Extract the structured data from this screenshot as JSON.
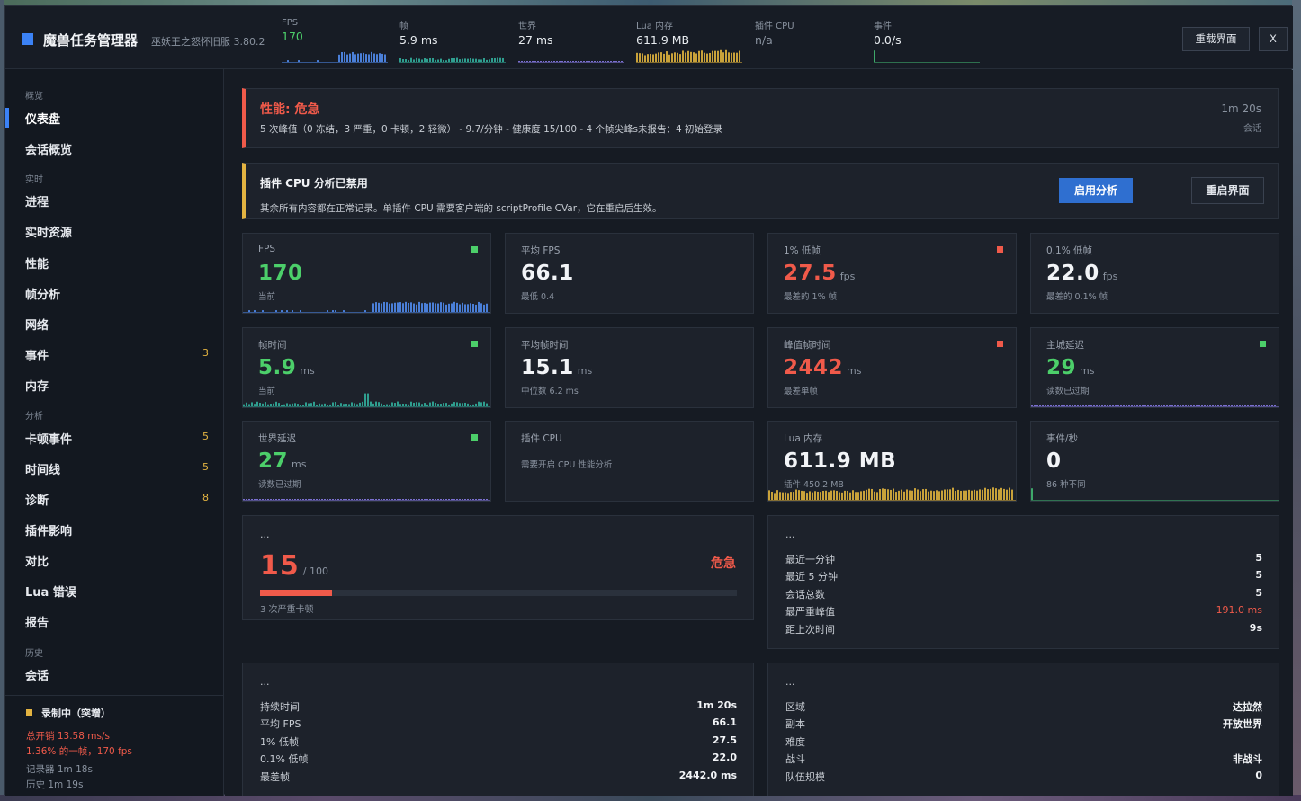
{
  "app": {
    "title": "魔兽任务管理器",
    "subtitle": "巫妖王之怒怀旧服 3.80.2",
    "reload_label": "重载界面",
    "close_label": "X"
  },
  "header_metrics": [
    {
      "label": "FPS",
      "value": "170",
      "tone": "green"
    },
    {
      "label": "帧",
      "value": "5.9 ms",
      "tone": "normal"
    },
    {
      "label": "世界",
      "value": "27 ms",
      "tone": "normal"
    },
    {
      "label": "Lua 内存",
      "value": "611.9 MB",
      "tone": "normal"
    },
    {
      "label": "插件 CPU",
      "value": "n/a",
      "tone": "dim"
    },
    {
      "label": "事件",
      "value": "0.0/s",
      "tone": "normal"
    }
  ],
  "sidebar": {
    "sections": [
      {
        "label": "概览",
        "items": [
          {
            "label": "仪表盘",
            "active": true
          },
          {
            "label": "会话概览"
          }
        ]
      },
      {
        "label": "实时",
        "items": [
          {
            "label": "进程"
          },
          {
            "label": "实时资源"
          },
          {
            "label": "性能"
          },
          {
            "label": "帧分析"
          },
          {
            "label": "网络"
          },
          {
            "label": "事件",
            "count": "3"
          },
          {
            "label": "内存"
          }
        ]
      },
      {
        "label": "分析",
        "items": [
          {
            "label": "卡顿事件",
            "count": "5"
          },
          {
            "label": "时间线",
            "count": "5"
          },
          {
            "label": "诊断",
            "count": "8"
          },
          {
            "label": "插件影响"
          },
          {
            "label": "对比"
          },
          {
            "label": "Lua 错误"
          },
          {
            "label": "报告"
          }
        ]
      },
      {
        "label": "历史",
        "items": [
          {
            "label": "会话"
          }
        ]
      }
    ],
    "footer": {
      "recording": "录制中（突增）",
      "overhead": "总开销 13.58 ms/s",
      "frame_pct": "1.36% 的一帧，170 fps",
      "recorder": "记录器 1m 18s",
      "history": "历史 1m 19s"
    }
  },
  "alert": {
    "title": "性能: 危急",
    "detail": "5 次峰值（0 冻结，3 严重，0 卡顿，2 轻微）  -  9.7/分钟  -  健康度 15/100  -  4 个帧尖峰s未报告：4 初始登录",
    "time": "1m 20s",
    "time_label": "会话"
  },
  "warning": {
    "title": "插件 CPU 分析已禁用",
    "detail": "其余所有内容都在正常记录。单插件 CPU 需要客户端的 scriptProfile CVar，它在重启后生效。",
    "enable_label": "启用分析",
    "restart_label": "重启界面"
  },
  "cards": [
    {
      "label": "FPS",
      "value": "170",
      "unit": "",
      "sub": "当前",
      "tone": "green",
      "dot": "g",
      "spark": "blue"
    },
    {
      "label": "平均 FPS",
      "value": "66.1",
      "unit": "",
      "sub": "最低 0.4",
      "tone": "normal",
      "dot": "",
      "spark": ""
    },
    {
      "label": "1% 低帧",
      "value": "27.5",
      "unit": "fps",
      "sub": "最差的 1% 帧",
      "tone": "red",
      "dot": "r",
      "spark": ""
    },
    {
      "label": "0.1% 低帧",
      "value": "22.0",
      "unit": "fps",
      "sub": "最差的 0.1% 帧",
      "tone": "normal",
      "dot": "",
      "spark": ""
    },
    {
      "label": "帧时间",
      "value": "5.9",
      "unit": "ms",
      "sub": "当前",
      "tone": "green",
      "dot": "g",
      "spark": "teal"
    },
    {
      "label": "平均帧时间",
      "value": "15.1",
      "unit": "ms",
      "sub": "中位数 6.2 ms",
      "tone": "normal",
      "dot": "",
      "spark": ""
    },
    {
      "label": "峰值帧时间",
      "value": "2442",
      "unit": "ms",
      "sub": "最差单帧",
      "tone": "red",
      "dot": "r",
      "spark": ""
    },
    {
      "label": "主城延迟",
      "value": "29",
      "unit": "ms",
      "sub": "读数已过期",
      "tone": "green",
      "dot": "g",
      "spark": "purple"
    },
    {
      "label": "世界延迟",
      "value": "27",
      "unit": "ms",
      "sub": "读数已过期",
      "tone": "green",
      "dot": "g",
      "spark": "purple"
    },
    {
      "label": "插件 CPU",
      "value": "",
      "unit": "",
      "sub": "需要开启 CPU 性能分析",
      "tone": "normal",
      "dot": "",
      "spark": ""
    },
    {
      "label": "Lua 内存",
      "value": "611.9 MB",
      "unit": "",
      "sub": "插件 450.2 MB",
      "tone": "normal",
      "dot": "",
      "spark": "gold"
    },
    {
      "label": "事件/秒",
      "value": "0",
      "unit": "",
      "sub": "86 种不同",
      "tone": "normal",
      "dot": "",
      "spark": "green"
    }
  ],
  "health": {
    "title": "...",
    "score": "15",
    "max": "/ 100",
    "score_fraction": 0.15,
    "status": "危急",
    "note": "3 次严重卡顿"
  },
  "spikes": {
    "title": "...",
    "rows": [
      {
        "k": "最近一分钟",
        "v": "5"
      },
      {
        "k": "最近 5 分钟",
        "v": "5"
      },
      {
        "k": "会话总数",
        "v": "5"
      },
      {
        "k": "最严重峰值",
        "v": "191.0 ms",
        "red": true
      },
      {
        "k": "距上次时间",
        "v": "9s"
      }
    ]
  },
  "session": {
    "title": "...",
    "rows": [
      {
        "k": "持续时间",
        "v": "1m 20s"
      },
      {
        "k": "平均 FPS",
        "v": "66.1"
      },
      {
        "k": "1% 低帧",
        "v": "27.5"
      },
      {
        "k": "0.1% 低帧",
        "v": "22.0"
      },
      {
        "k": "最差帧",
        "v": "2442.0 ms"
      }
    ]
  },
  "zone": {
    "title": "...",
    "rows": [
      {
        "k": "区域",
        "v": "达拉然"
      },
      {
        "k": "副本",
        "v": "开放世界"
      },
      {
        "k": "难度",
        "v": ""
      },
      {
        "k": "战斗",
        "v": "非战斗"
      },
      {
        "k": "队伍规模",
        "v": "0"
      }
    ]
  },
  "colors": {
    "accent": "#3b82f6",
    "good": "#4ccf6a",
    "bad": "#f05a4a",
    "warn": "#e3b341"
  }
}
